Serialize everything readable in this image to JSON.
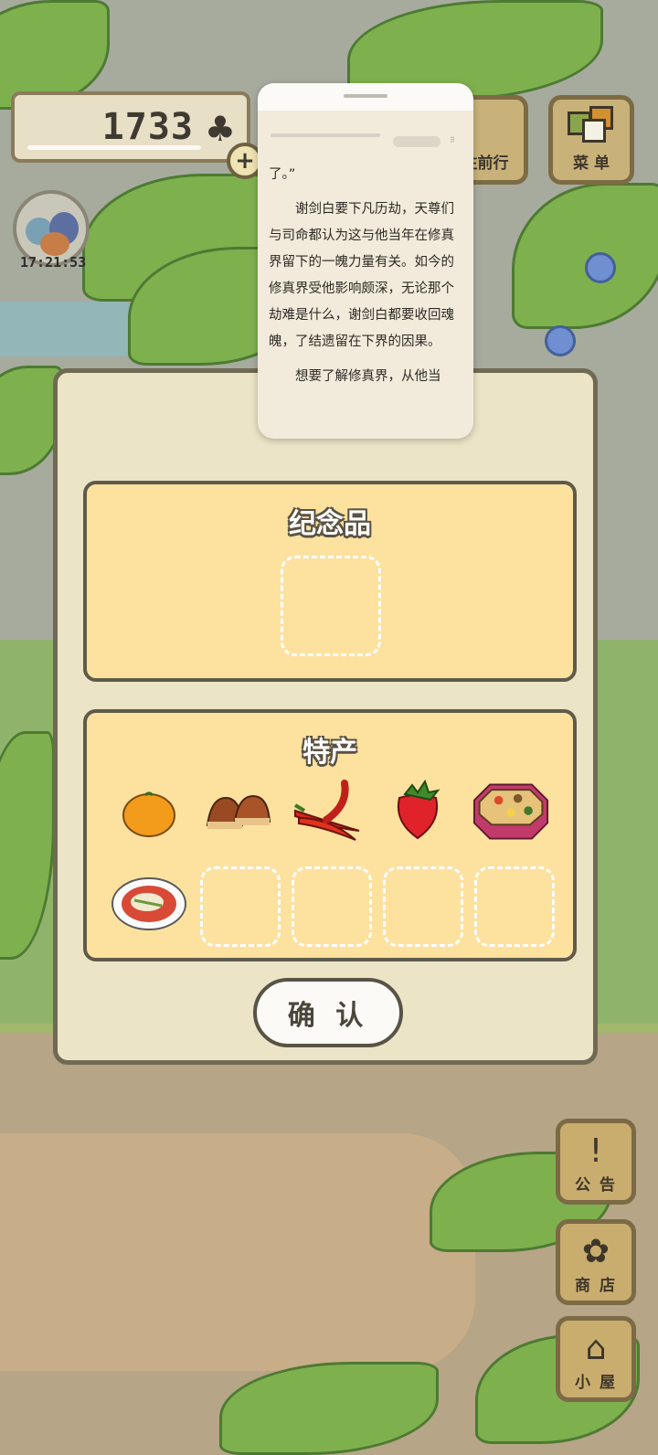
{
  "counter": {
    "value": "1733",
    "plus": "+"
  },
  "clock": {
    "time": "17:21:53"
  },
  "top_buttons": [
    {
      "label": "往前行"
    },
    {
      "label": "菜 单"
    }
  ],
  "reader": {
    "paragraphs": [
      "了。”",
      "谢剑白要下凡历劫，天尊们与司命都认为这与他当年在修真界留下的一魄力量有关。如今的修真界受他影响颇深，无论那个劫难是什么，谢剑白都要收回魂魄，了结遗留在下界的因果。",
      "想要了解修真界，从他当"
    ]
  },
  "dialog": {
    "souvenir_title": "纪念品",
    "specialty_title": "特产",
    "confirm_label": "确 认",
    "specialty_items": [
      "orange",
      "chestnuts",
      "chili-peppers",
      "strawberry",
      "osechi-box",
      "plate-dish"
    ]
  },
  "side_buttons": [
    {
      "label": "公 告",
      "icon": "!"
    },
    {
      "label": "商 店",
      "icon": "✿"
    },
    {
      "label": "小 屋",
      "icon": "⌂"
    }
  ],
  "colors": {
    "panel": "#ece4c6",
    "box": "#fde19f",
    "border": "#5e5b4b",
    "button": "#c9ad6e"
  }
}
